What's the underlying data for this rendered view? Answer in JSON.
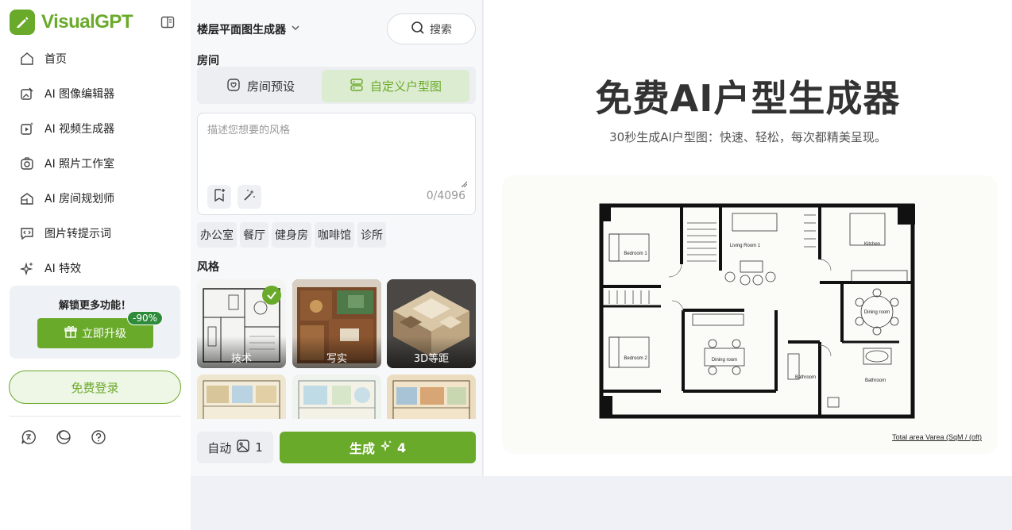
{
  "app": {
    "brand": "VisualGPT",
    "brand_color": "#6aaa2a"
  },
  "sidebar": {
    "items": [
      {
        "label": "首页",
        "icon": "home-icon"
      },
      {
        "label": "AI 图像编辑器",
        "icon": "image-edit-icon"
      },
      {
        "label": "AI 视频生成器",
        "icon": "video-spark-icon"
      },
      {
        "label": "AI 照片工作室",
        "icon": "camera-icon"
      },
      {
        "label": "AI 房间规划师",
        "icon": "house-plan-icon"
      },
      {
        "label": "图片转提示词",
        "icon": "chat-code-icon"
      },
      {
        "label": "AI 特效",
        "icon": "sparkles-icon"
      }
    ],
    "upgrade": {
      "title": "解锁更多功能！",
      "button": "立即升级",
      "badge": "-90%"
    },
    "login": "免费登录",
    "bottom_icons": [
      "language-icon",
      "theme-icon",
      "help-icon"
    ]
  },
  "panel": {
    "tool_name": "楼层平面图生成器",
    "search": "搜索",
    "room_label": "房间",
    "tabs": [
      {
        "label": "房间预设",
        "active": false
      },
      {
        "label": "自定义户型图",
        "active": true
      }
    ],
    "prompt": {
      "placeholder": "描述您想要的风格",
      "value": "",
      "count": "0/4096"
    },
    "chips": [
      "办公室",
      "餐厅",
      "健身房",
      "咖啡馆",
      "诊所"
    ],
    "style_label": "风格",
    "styles": [
      {
        "label": "技术",
        "selected": true
      },
      {
        "label": "写实",
        "selected": false
      },
      {
        "label": "3D等距",
        "selected": false
      },
      {
        "label": "",
        "selected": false
      },
      {
        "label": "",
        "selected": false
      },
      {
        "label": "",
        "selected": false
      }
    ],
    "auto": "自动",
    "image_count": "1",
    "generate": "生成",
    "credits": "4"
  },
  "main": {
    "title": "免费AI户型生成器",
    "subtitle": "30秒生成AI户型图：快速、轻松，每次都精美呈现。",
    "plan_labels": {
      "bedroom1": "Bedroom 1",
      "living": "Living Room 1",
      "kitchen": "Kitchen",
      "dining_round": "Dining room",
      "bedroom2": "Bedroom 2",
      "dining": "Dining room",
      "bath1": "Bathroom",
      "bath2": "Bathroom"
    },
    "total_area": "Total area Varea (SqM / (oft)"
  }
}
